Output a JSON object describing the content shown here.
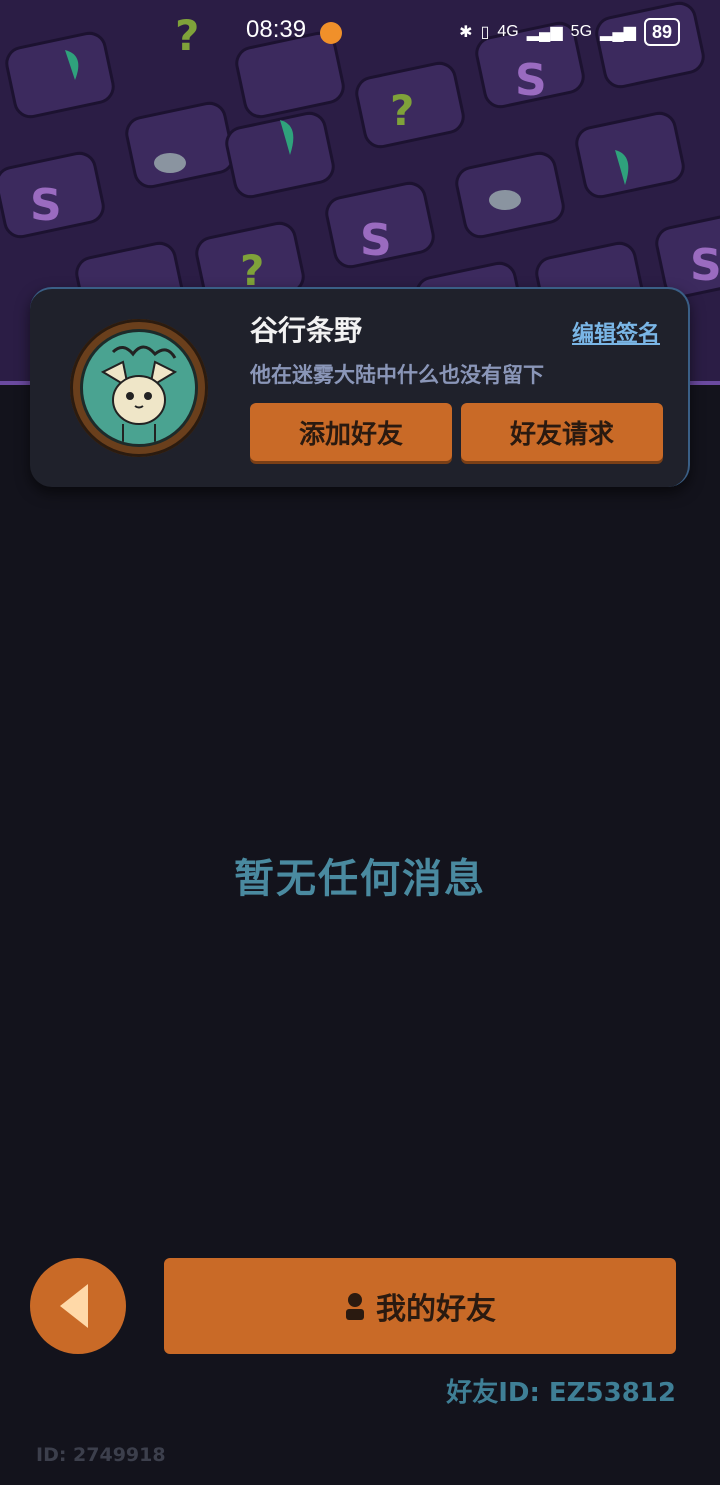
{
  "status_bar": {
    "time": "08:39",
    "network_4g": "4G",
    "network_5g": "5G",
    "battery": "89"
  },
  "profile": {
    "username": "谷行条野",
    "signature": "他在迷雾大陆中什么也没有留下",
    "edit_signature_label": "编辑签名",
    "add_friend_label": "添加好友",
    "friend_requests_label": "好友请求"
  },
  "main": {
    "empty_message": "暂无任何消息"
  },
  "footer": {
    "my_friends_label": "我的好友",
    "friend_id": "好友ID: EZ53812",
    "user_id": "ID: 2749918"
  },
  "colors": {
    "accent": "#c96a27",
    "background": "#13131c",
    "header_pattern": "#2b1d45",
    "link": "#7ab6e6",
    "empty_text": "#4a8aa0"
  }
}
